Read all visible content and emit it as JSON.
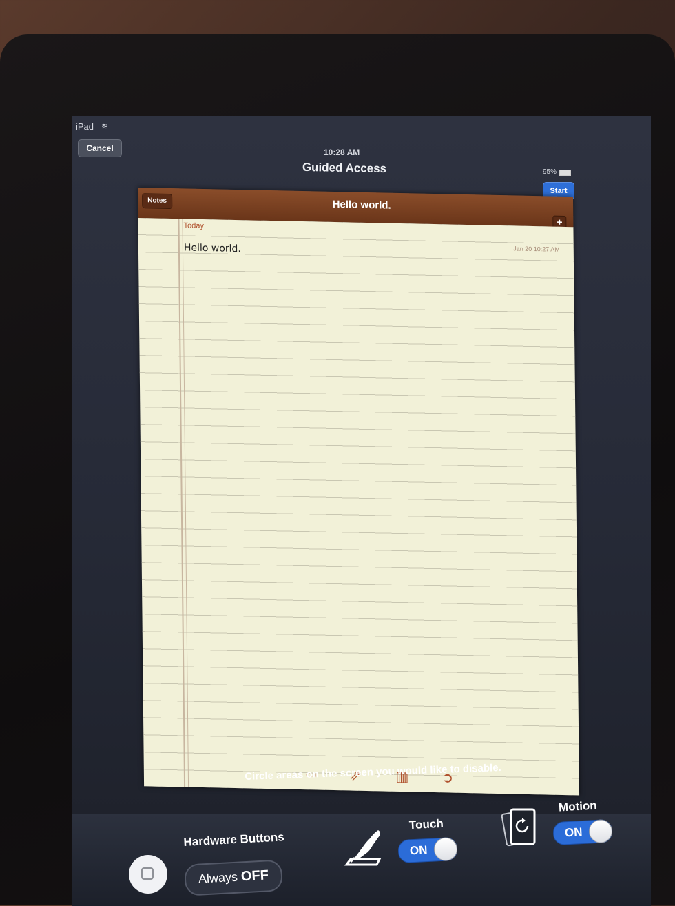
{
  "status": {
    "device_name": "iPad",
    "time": "10:28 AM",
    "battery": "95%"
  },
  "nav": {
    "cancel_label": "Cancel",
    "title": "Guided Access",
    "start_label": "Start"
  },
  "notes_app": {
    "back_label": "Notes",
    "title": "Hello world.",
    "add_label": "+",
    "section_label": "Today",
    "date_label": "Jan 20   10:27 AM",
    "note_text": "Hello world.",
    "toolbar_icons": [
      "left-arrow-icon",
      "share-icon",
      "trash-icon",
      "right-arrow-icon"
    ]
  },
  "instruction": "Circle areas on the screen you would like to disable.",
  "controls": {
    "hardware_buttons_label": "Hardware Buttons",
    "hardware_buttons_value_prefix": "Always",
    "hardware_buttons_value": "OFF",
    "touch_label": "Touch",
    "touch_value": "ON",
    "motion_label": "Motion",
    "motion_value": "ON"
  },
  "colors": {
    "accent": "#2b6cd8",
    "notes_header": "#7a4020",
    "paper": "#f2f1d8"
  }
}
